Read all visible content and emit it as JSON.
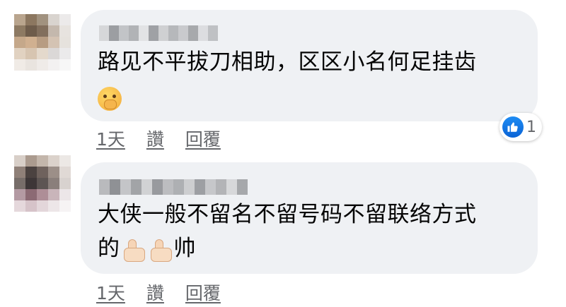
{
  "comments": [
    {
      "text_line1": "路见不平拔刀相助，区区小名何足挂齿",
      "emoji_line2": "hand-over-mouth-emoji",
      "actions": {
        "time": "1天",
        "like": "讚",
        "reply": "回覆"
      },
      "reaction": {
        "icon": "like-icon",
        "count": "1"
      }
    },
    {
      "text_line1": "大侠一般不留名不留号码不留联络方式",
      "text_line2_prefix": "的",
      "text_line2_suffix": "帅",
      "emoji_line2": "thumbs-up-emoji",
      "actions": {
        "time": "1天",
        "like": "讚",
        "reply": "回覆"
      }
    }
  ],
  "colors": {
    "bubble": "#eff1f4",
    "text": "#050505",
    "secondary": "#65676b",
    "like_blue": "#1877f2"
  }
}
